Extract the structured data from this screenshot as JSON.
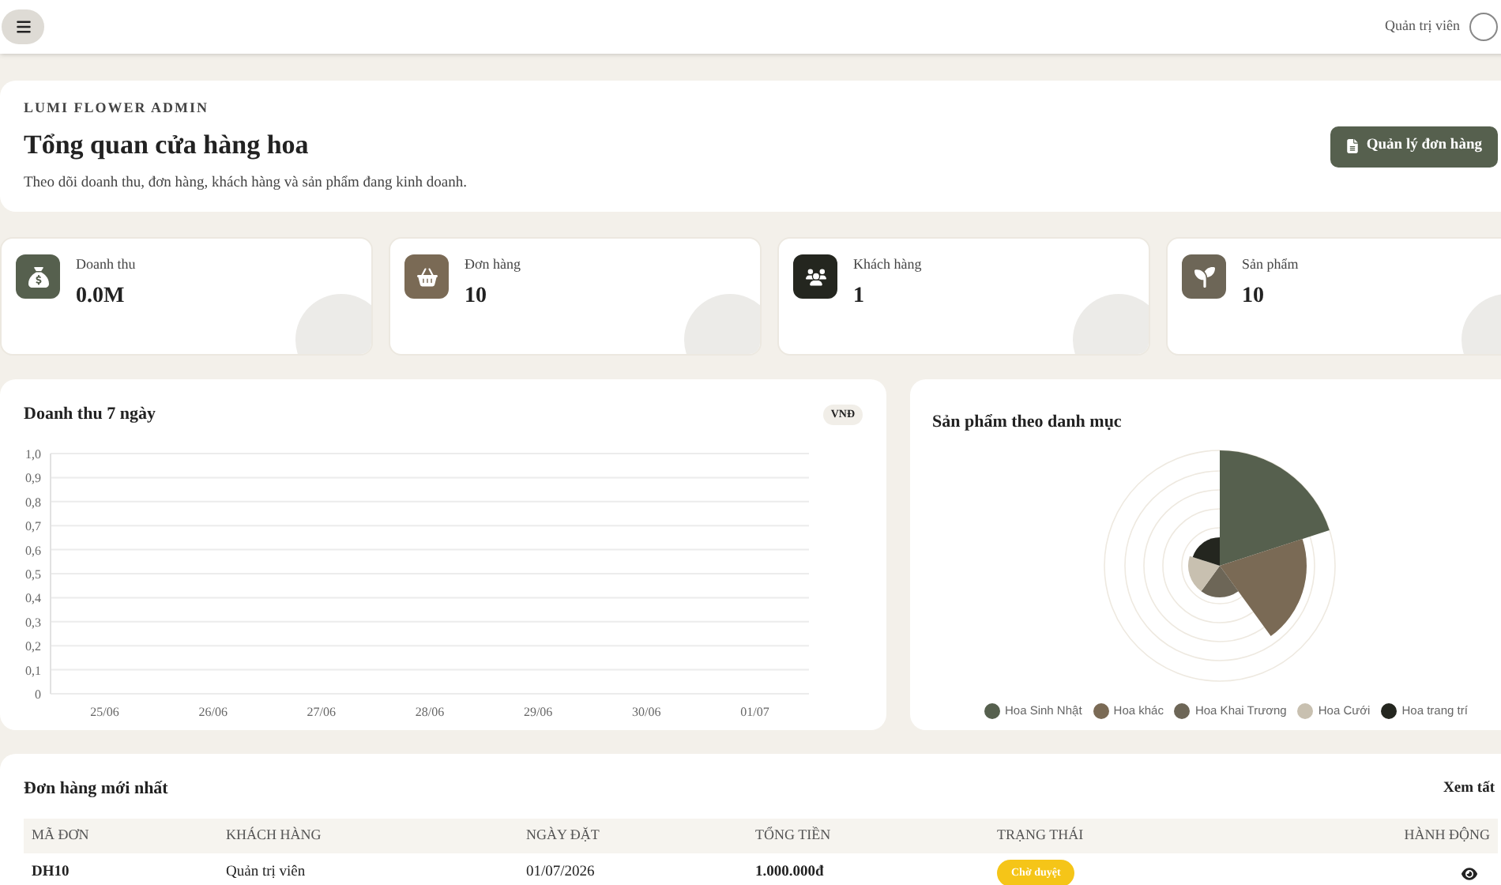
{
  "topbar": {
    "user_name": "Quản trị viên"
  },
  "hero": {
    "eyebrow": "LUMI FLOWER ADMIN",
    "title": "Tổng quan cửa hàng hoa",
    "subtitle": "Theo dõi doanh thu, đơn hàng, khách hàng và sản phẩm đang kinh doanh.",
    "button": "Quản lý đơn hàng"
  },
  "stats": [
    {
      "kind": "revenue",
      "label": "Doanh thu",
      "value": "0.0M",
      "color": "#56604e"
    },
    {
      "kind": "orders",
      "label": "Đơn hàng",
      "value": "10",
      "color": "#7a6a55"
    },
    {
      "kind": "customers",
      "label": "Khách hàng",
      "value": "1",
      "color": "#24261f"
    },
    {
      "kind": "products",
      "label": "Sản phẩm",
      "value": "10",
      "color": "#6d6657"
    }
  ],
  "revenue_chart": {
    "title": "Doanh thu 7 ngày",
    "badge": "VNĐ",
    "chart_data": {
      "type": "line",
      "grid": true,
      "categories": [
        "25/06",
        "26/06",
        "27/06",
        "28/06",
        "29/06",
        "30/06",
        "01/07"
      ],
      "ylim": [
        0,
        1
      ],
      "yticks": [
        {
          "value": 0,
          "label": "0"
        },
        {
          "value": 0.1,
          "label": "0,1"
        },
        {
          "value": 0.2,
          "label": "0,2"
        },
        {
          "value": 0.3,
          "label": "0,3"
        },
        {
          "value": 0.4,
          "label": "0,4"
        },
        {
          "value": 0.5,
          "label": "0,5"
        },
        {
          "value": 0.6,
          "label": "0,6"
        },
        {
          "value": 0.7,
          "label": "0,7"
        },
        {
          "value": 0.8,
          "label": "0,8"
        },
        {
          "value": 0.9,
          "label": "0,9"
        },
        {
          "value": 1,
          "label": "1,0"
        }
      ]
    }
  },
  "category_chart": {
    "title": "Sản phẩm theo danh mục",
    "legend": [
      {
        "label": "Hoa Sinh Nhật",
        "color": "#56604e"
      },
      {
        "label": "Hoa khác",
        "color": "#7a6a55"
      },
      {
        "label": "Hoa Khai Trương",
        "color": "#6d6657"
      },
      {
        "label": "Hoa Cưới",
        "color": "#c8c0b0"
      },
      {
        "label": "Hoa trang trí",
        "color": "#24261f"
      }
    ]
  },
  "orders": {
    "title": "Đơn hàng mới nhất",
    "link": "Xem tất",
    "columns": [
      "MÃ ĐƠN",
      "KHÁCH HÀNG",
      "NGÀY ĐẶT",
      "TỔNG TIỀN",
      "TRẠNG THÁI",
      "HÀNH ĐỘNG"
    ],
    "rows": [
      {
        "id": "DH10",
        "customer": "Quản trị viên",
        "date": "01/07/2026",
        "total": "1.000.000đ",
        "status": "Chờ duyệt"
      }
    ]
  }
}
